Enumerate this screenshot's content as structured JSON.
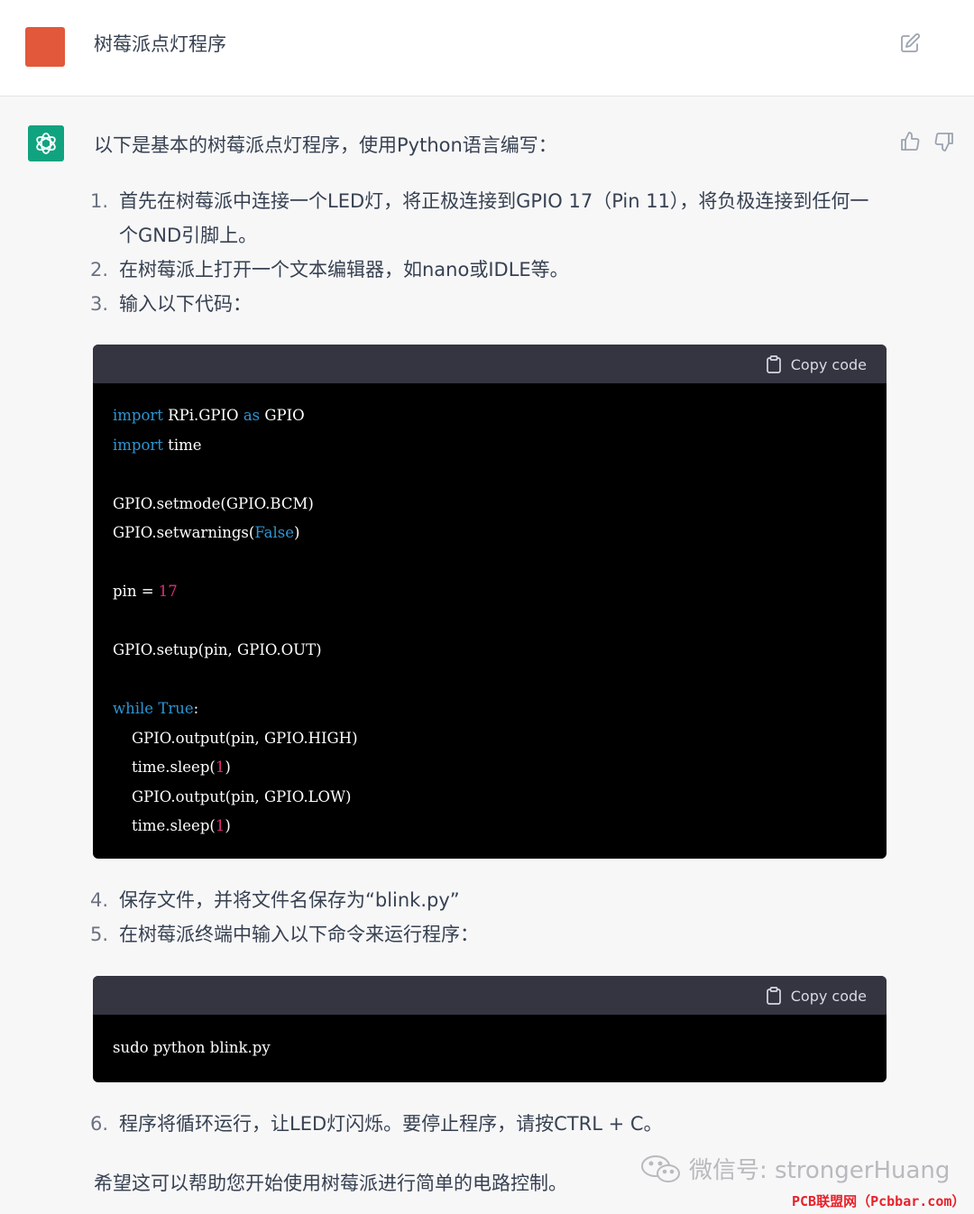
{
  "user": {
    "message": "树莓派点灯程序"
  },
  "assistant": {
    "intro": "以下是基本的树莓派点灯程序，使用Python语言编写：",
    "steps": [
      {
        "num": "1.",
        "text": "首先在树莓派中连接一个LED灯，将正极连接到GPIO 17（Pin 11），将负极连接到任何一个GND引脚上。"
      },
      {
        "num": "2.",
        "text": "在树莓派上打开一个文本编辑器，如nano或IDLE等。"
      },
      {
        "num": "3.",
        "text": "输入以下代码："
      },
      {
        "num": "4.",
        "text": "保存文件，并将文件名保存为“blink.py”"
      },
      {
        "num": "5.",
        "text": "在树莓派终端中输入以下命令来运行程序："
      },
      {
        "num": "6.",
        "text": "程序将循环运行，让LED灯闪烁。要停止程序，请按CTRL + C。"
      }
    ],
    "copy_label": "Copy code",
    "code1": {
      "l1_kw": "import",
      "l1_mod": " RPi.GPIO ",
      "l1_as": "as",
      "l1_alias": " GPIO",
      "l2_kw": "import",
      "l2_mod": " time",
      "l3": "GPIO.setmode(GPIO.BCM)",
      "l4_a": "GPIO.setwarnings(",
      "l4_b": "False",
      "l4_c": ")",
      "l5_a": "pin = ",
      "l5_b": "17",
      "l6": "GPIO.setup(pin, GPIO.OUT)",
      "l7_a": "while",
      "l7_b": " True",
      "l7_c": ":",
      "l8": "    GPIO.output(pin, GPIO.HIGH)",
      "l9_a": "    time.sleep(",
      "l9_b": "1",
      "l9_c": ")",
      "l10": "    GPIO.output(pin, GPIO.LOW)",
      "l11_a": "    time.sleep(",
      "l11_b": "1",
      "l11_c": ")"
    },
    "code2": {
      "l1": "sudo python blink.py"
    },
    "closing": "希望这可以帮助您开始使用树莓派进行简单的电路控制。"
  },
  "watermark": {
    "text": "微信号: strongerHuang",
    "site": "PCB联盟网（Pcbbar.com）"
  },
  "icons": {
    "edit": "edit-icon",
    "thumbs_up": "thumbs-up-icon",
    "thumbs_down": "thumbs-down-icon",
    "copy": "clipboard-icon",
    "assistant_logo": "openai-logo-icon",
    "wechat": "wechat-icon"
  },
  "colors": {
    "user_avatar": "#e2583b",
    "assistant_avatar": "#10a37f",
    "keyword": "#2e95d3",
    "number": "#df3079",
    "site_text": "#e8222b"
  }
}
